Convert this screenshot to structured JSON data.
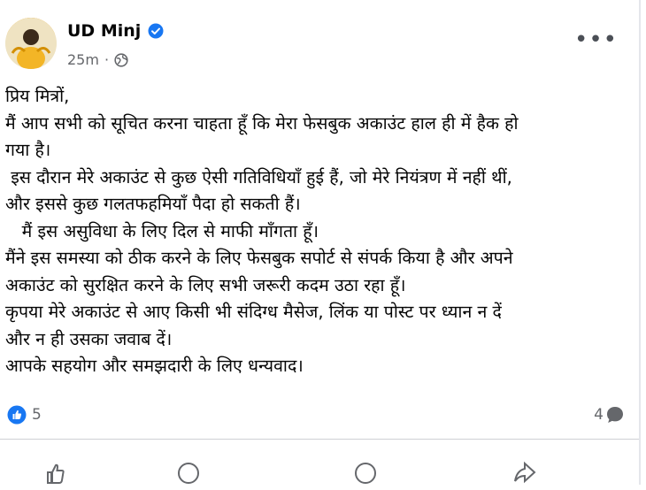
{
  "post": {
    "author": "UD Minj",
    "time": "25m",
    "separator": "·",
    "more_label": "•••",
    "body_lines": [
      "प्रिय मित्रों,",
      "मैं आप सभी को सूचित करना चाहता हूँ कि मेरा फेसबुक अकाउंट हाल ही में हैक हो",
      "गया है।",
      " इस दौरान मेरे अकाउंट से कुछ ऐसी गतिविधियाँ हुई हैं, जो मेरे नियंत्रण में नहीं थीं,",
      "और इससे कुछ गलतफहमियाँ पैदा हो सकती हैं।",
      "   मैं इस असुविधा के लिए दिल से माफी माँगता हूँ।",
      "मैंने इस समस्या को ठीक करने के लिए फेसबुक सपोर्ट से संपर्क किया है और अपने",
      "अकाउंट को सुरक्षित करने के लिए सभी जरूरी कदम उठा रहा हूँ।",
      "कृपया मेरे अकाउंट से आए किसी भी संदिग्ध मैसेज, लिंक या पोस्ट पर ध्यान न दें",
      "और न ही उसका जवाब दें।",
      "आपके सहयोग और समझदारी के लिए धन्यवाद।"
    ],
    "reaction_count": "5",
    "comment_count": "4"
  },
  "icons": {
    "verified": "verified-badge-icon",
    "privacy": "globe-icon",
    "reaction": "like-icon",
    "comments": "comment-icon"
  },
  "colors": {
    "brand_blue": "#1877f2",
    "secondary_text": "#65676b"
  }
}
